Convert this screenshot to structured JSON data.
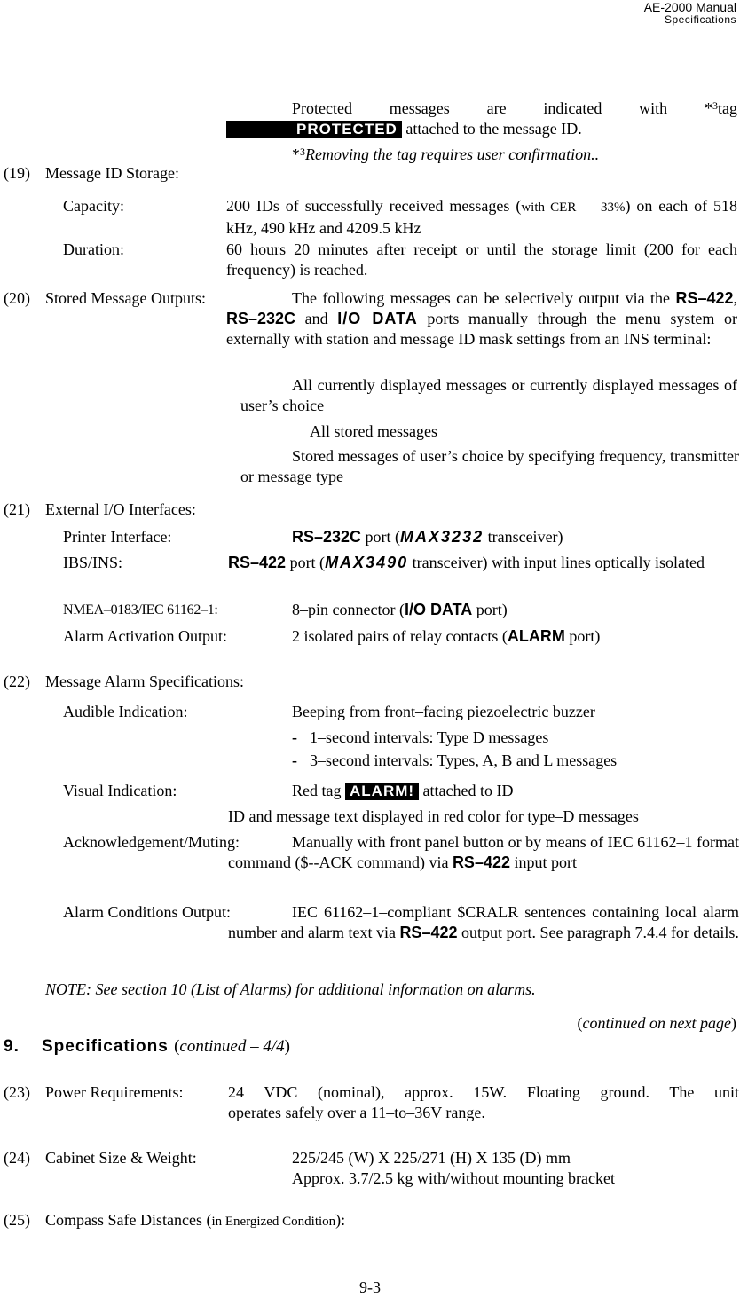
{
  "header": {
    "manual_title": "AE-2000 Manual",
    "section_name": "Specifications"
  },
  "protected_block": {
    "line1_text": "Protected messages are indicated with",
    "footnote_mark": "*",
    "footnote_num": "3",
    "line1_end": "tag",
    "tag_label": "PROTECTED",
    "line2_text": "attached to the message ID.",
    "footnote_text": "Removing the tag requires user confirmation."
  },
  "items": {
    "i19": {
      "number": "(19)",
      "title": "Message ID Storage:",
      "capacity_label": "Capacity:",
      "capacity_text_a": "200 IDs of successfully received messages (",
      "capacity_small": "with CER",
      "capacity_small2": "33%",
      "capacity_text_b": ") on each of 518 kHz, 490 kHz and 4209.5 kHz",
      "duration_label": "Duration:",
      "duration_text": "60 hours 20 minutes after receipt or until the storage limit (200 for each frequency) is reached."
    },
    "i20": {
      "number": "(20)",
      "title": "Stored Message Outputs:",
      "text_a": "The following messages can be selectively output via the",
      "port1": "RS–422",
      "port2": "RS–232C",
      "and": "and",
      "port3": "I/O DATA",
      "text_b": "ports manually through the menu system or externally with station and message ID mask settings from an INS terminal:",
      "options": [
        "All currently displayed messages or currently displayed messages of user’s choice",
        "All stored messages",
        "Stored messages of user’s choice by specifying frequency, transmitter or message type"
      ]
    },
    "i21": {
      "number": "(21)",
      "title": "External I/O Interfaces:",
      "printer_label": "Printer Interface:",
      "printer_port": "RS–232C",
      "printer_text_a": "port (",
      "printer_chip": "MAX3232",
      "printer_text_b": "transceiver)",
      "ibs_label": "IBS/INS:",
      "ibs_port": "RS–422",
      "ibs_text_a": "port (",
      "ibs_chip": "MAX3490",
      "ibs_text_b": "transceiver) with input lines optically isolated",
      "nmea_label": "NMEA–0183/IEC 61162–1:",
      "nmea_text_a": "8–pin connector (",
      "nmea_port": "I/O DATA",
      "nmea_text_b": "port)",
      "alarm_label": "Alarm Activation Output:",
      "alarm_text_a": "2 isolated pairs of relay contacts (",
      "alarm_port": "ALARM",
      "alarm_text_b": "port)"
    },
    "i22": {
      "number": "(22)",
      "title": "Message Alarm Specifications:",
      "audible_label": "Audible Indication:",
      "audible_text": "Beeping from front–facing piezoelectric buzzer",
      "audible_bullets": [
        "1–second intervals: Type D messages",
        "3–second intervals: Types, A, B and L messages"
      ],
      "bullet_mark": "-",
      "visual_label": "Visual Indication:",
      "visual_text_a": "Red tag",
      "visual_tag": "ALARM!",
      "visual_text_b": "attached to ID",
      "visual_text_2": "ID and message text displayed in red color for type–D messages",
      "ack_label": "Acknowledgement/Muting:",
      "ack_text_a": "Manually with front panel button or by means of IEC 61162–1 format command ($--ACK command) via",
      "ack_port": "RS–422",
      "ack_text_b": "input port",
      "cond_label": "Alarm Conditions Output:",
      "cond_text_a": "IEC 61162–1–compliant $CRALR sentences containing local alarm number and alarm text via",
      "cond_port": "RS–422",
      "cond_text_b": "output port. See paragraph 7.4.4 for details."
    },
    "note": "NOTE: See section 10 (List of Alarms) for additional information on alarms.",
    "continued": "continued on next page",
    "section": {
      "number": "9.",
      "title": "Specifications",
      "subtitle": "continued – 4/4"
    },
    "i23": {
      "number": "(23)",
      "title": "Power Requirements:",
      "text_a": "24 VDC (nominal), approx. 15W. Floating ground. The unit",
      "text_b": "operates safely over a 11–to–36V range."
    },
    "i24": {
      "number": "(24)",
      "title": "Cabinet Size & Weight:",
      "size_text": "225/245 (W) X 225/271 (H) X 135 (D) mm",
      "weight_text": "Approx. 3.7/2.5 kg with/without mounting bracket"
    },
    "i25": {
      "number": "(25)",
      "title": "Compass Safe Distances (",
      "title_small": "in Energized Condition",
      "title_end": "):"
    }
  },
  "footer": {
    "page_number": "9-3"
  }
}
